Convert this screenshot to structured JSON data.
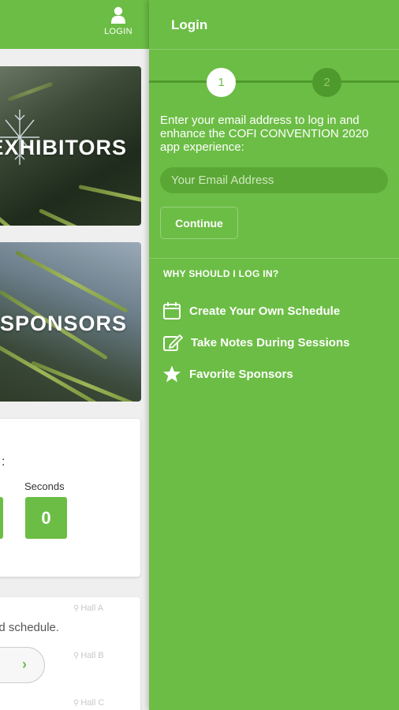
{
  "header": {
    "login_label": "LOGIN"
  },
  "tiles": [
    {
      "title": "EXHIBITORS"
    },
    {
      "title": "SPONSORS"
    }
  ],
  "countdown": {
    "colon": ":",
    "seconds_label": "Seconds",
    "seconds_value": "0"
  },
  "schedule_card": {
    "text": "ed schedule.",
    "halls": [
      "Hall A",
      "Hall B",
      "Hall C"
    ]
  },
  "drawer": {
    "title": "Login",
    "steps": [
      "1",
      "2"
    ],
    "intro": "Enter your email address to log in and enhance the COFI CONVENTION 2020 app experience:",
    "email_placeholder": "Your Email Address",
    "continue_label": "Continue",
    "why_heading": "WHY SHOULD I LOG IN?",
    "features": [
      {
        "label": "Create Your Own Schedule",
        "icon": "calendar-icon"
      },
      {
        "label": "Take Notes During Sessions",
        "icon": "note-edit-icon"
      },
      {
        "label": "Favorite Sponsors",
        "icon": "star-icon"
      }
    ]
  },
  "colors": {
    "brand_green": "#6cbd45",
    "dark_green": "#4f9a2c"
  }
}
